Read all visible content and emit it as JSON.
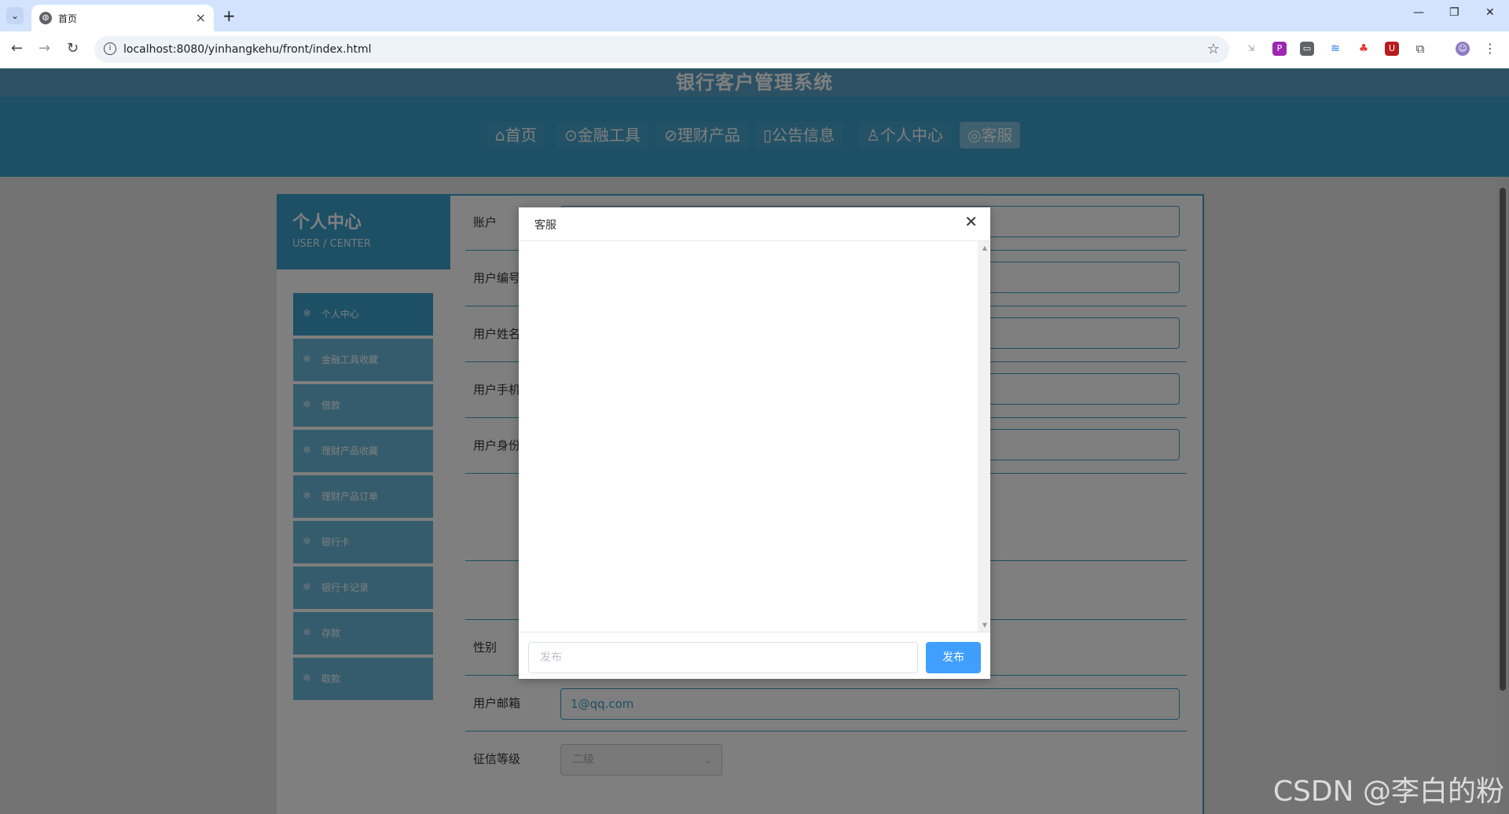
{
  "browser": {
    "tab_title": "首页",
    "url": "localhost:8080/yinhangkehu/front/index.html"
  },
  "site": {
    "title": "银行客户管理系统",
    "nav": [
      {
        "icon": "⌂",
        "label": "首页"
      },
      {
        "icon": "⊙",
        "label": "金融工具"
      },
      {
        "icon": "⊘",
        "label": "理财产品"
      },
      {
        "icon": "▯",
        "label": "公告信息"
      },
      {
        "icon": "♙",
        "label": "个人中心"
      },
      {
        "icon": "◎",
        "label": "客服"
      }
    ],
    "active_nav": "客服"
  },
  "user_center": {
    "title": "个人中心",
    "subtitle": "USER / CENTER",
    "menu": [
      {
        "label": "个人中心"
      },
      {
        "label": "金融工具收藏"
      },
      {
        "label": "借款"
      },
      {
        "label": "理财产品收藏"
      },
      {
        "label": "理财产品订单"
      },
      {
        "label": "银行卡"
      },
      {
        "label": "银行卡记录"
      },
      {
        "label": "存款"
      },
      {
        "label": "取款"
      }
    ]
  },
  "form": {
    "account_label": "账户",
    "user_no_label": "用户编号",
    "user_name_label": "用户姓名",
    "user_phone_label": "用户手机",
    "user_id_label": "用户身份",
    "gender_label": "性别",
    "email_label": "用户邮箱",
    "email_value": "1@qq.com",
    "credit_label": "征信等级",
    "credit_value": "二级"
  },
  "dialog": {
    "title": "客服",
    "input_placeholder": "发布",
    "send_label": "发布"
  },
  "watermark": "CSDN @李白的粉"
}
